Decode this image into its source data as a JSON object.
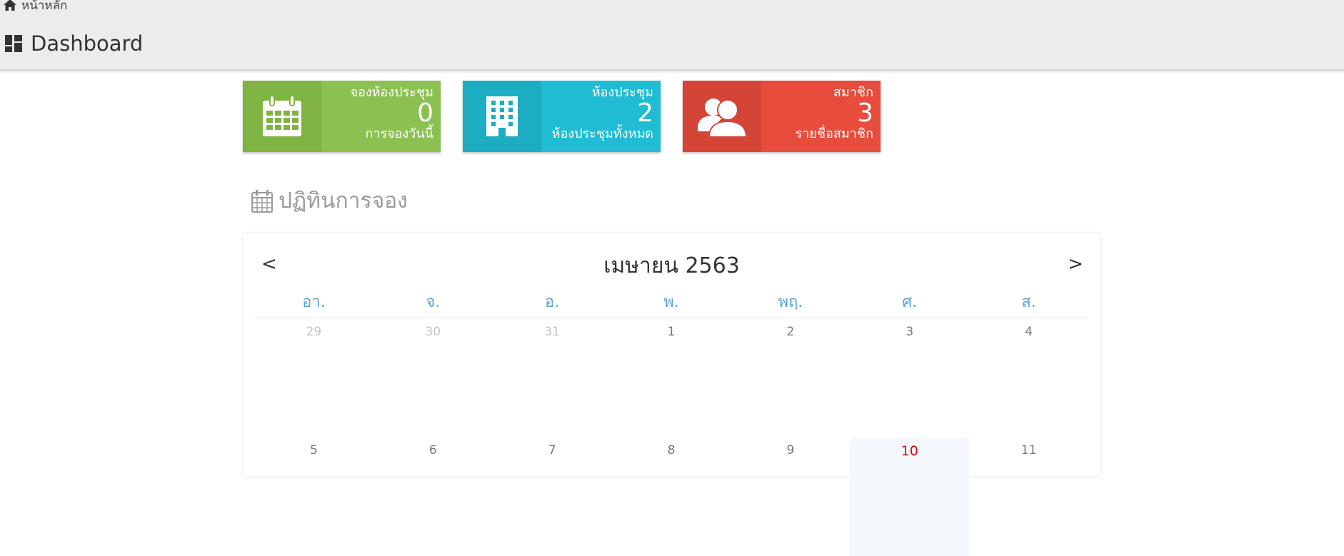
{
  "breadcrumb": {
    "home_label": "หน้าหลัก"
  },
  "header": {
    "title": "Dashboard"
  },
  "tiles": [
    {
      "label": "จองห้องประชุม",
      "count": "0",
      "sub": "การจองวันนี้",
      "color": "#8cc152",
      "icon": "calendar-icon"
    },
    {
      "label": "ห้องประชุม",
      "count": "2",
      "sub": "ห้องประชุมทั้งหมด",
      "color": "#1fbcd3",
      "icon": "building-icon"
    },
    {
      "label": "สมาชิก",
      "count": "3",
      "sub": "รายชื่อสมาชิก",
      "color": "#e74c3c",
      "icon": "users-icon"
    }
  ],
  "section": {
    "title": "ปฏิทินการจอง"
  },
  "calendar": {
    "prev_label": "<",
    "next_label": ">",
    "month_label": "เมษายน 2563",
    "weekdays": [
      "อา.",
      "จ.",
      "อ.",
      "พ.",
      "พฤ.",
      "ศ.",
      "ส."
    ],
    "weeks": [
      [
        "29",
        "30",
        "31",
        "1",
        "2",
        "3",
        "4"
      ],
      [
        "5",
        "6",
        "7",
        "8",
        "9",
        "10",
        "11"
      ]
    ],
    "today": "10",
    "today_color": "#e00000",
    "weekday_color": "#5aa5d6"
  }
}
